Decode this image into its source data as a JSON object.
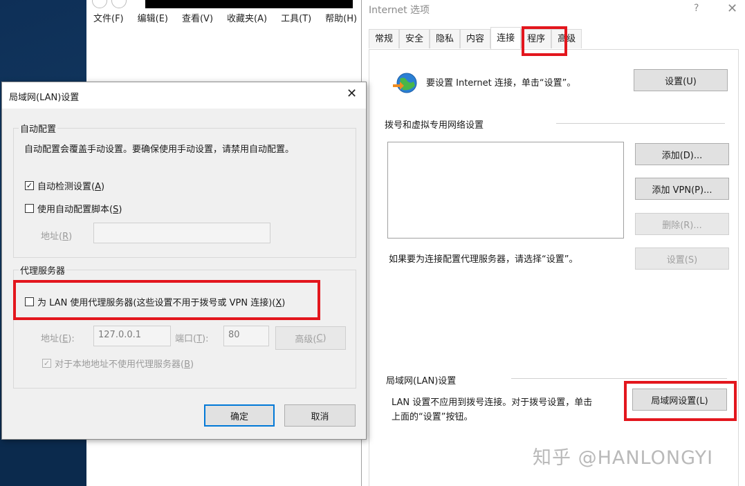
{
  "browser": {
    "menu": [
      "文件(F)",
      "编辑(E)",
      "查看(V)",
      "收藏夹(A)",
      "工具(T)",
      "帮助(H)"
    ]
  },
  "inet": {
    "title": "Internet 选项",
    "help": "?",
    "close": "✕",
    "tabs": [
      "常规",
      "安全",
      "隐私",
      "内容",
      "连接",
      "程序",
      "高级"
    ],
    "active_tab": "连接",
    "setup_text": "要设置 Internet 连接，单击“设置”。",
    "setup_button": "设置(U)",
    "dialup_header": "拨号和虚拟专用网络设置",
    "add_button": "添加(D)...",
    "add_vpn_button": "添加 VPN(P)...",
    "remove_button": "删除(R)...",
    "proxy_hint": "如果要为连接配置代理服务器，请选择“设置”。",
    "settings_button": "设置(S)",
    "lan_header": "局域网(LAN)设置",
    "lan_text_line1": "LAN 设置不应用到拨号连接。对于拨号设置，单击",
    "lan_text_line2": "上面的“设置”按钮。",
    "lan_settings_button": "局域网设置(L)"
  },
  "lan": {
    "title": "局域网(LAN)设置",
    "close": "✕",
    "auto_group": "自动配置",
    "auto_desc": "自动配置会覆盖手动设置。要确保使用手动设置，请禁用自动配置。",
    "auto_detect": {
      "label": "自动检测设置(",
      "key": "A",
      "end": ")",
      "checked": true
    },
    "auto_script": {
      "label": "使用自动配置脚本(",
      "key": "S",
      "end": ")",
      "checked": false
    },
    "address_label": "地址(",
    "address_key": "R",
    "address_end": ")",
    "proxy_group": "代理服务器",
    "use_proxy": {
      "label": "为 LAN 使用代理服务器(这些设置不用于拨号或 VPN 连接)(",
      "key": "X",
      "end": ")",
      "checked": false
    },
    "proxy_address_label": "地址(",
    "proxy_address_key": "E",
    "proxy_address_end": "):",
    "proxy_address_value": "127.0.0.1",
    "port_label": "端口(",
    "port_key": "T",
    "port_end": "):",
    "port_value": "80",
    "advanced_button": "高级(",
    "advanced_key": "C",
    "advanced_end": ")",
    "bypass_local": {
      "label": "对于本地地址不使用代理服务器(",
      "key": "B",
      "end": ")",
      "checked": true
    },
    "ok_button": "确定",
    "cancel_button": "取消"
  },
  "watermark": "知乎 @HANLONGYI",
  "colors": {
    "highlight": "#e3161d",
    "focus_border": "#0078d7"
  }
}
